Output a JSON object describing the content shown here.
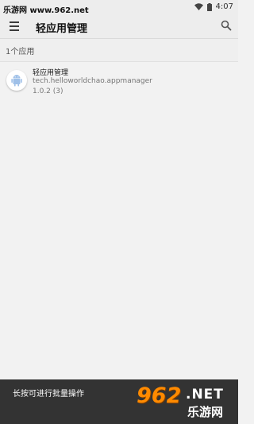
{
  "status_bar": {
    "watermark": "乐游网 www.962.net",
    "time": "4:07"
  },
  "app_bar": {
    "title": "轻应用管理"
  },
  "section": {
    "count_label": "1个应用"
  },
  "apps": [
    {
      "name": "轻应用管理",
      "package": "tech.helloworldchao.appmanager",
      "version": "1.0.2 (3)"
    }
  ],
  "snackbar": {
    "message": "长按可进行批量操作"
  },
  "logo": {
    "number": "962",
    "net": ".NET",
    "cn": "乐游网"
  },
  "colors": {
    "app_bar_bg": "#ededed",
    "snackbar_bg": "#333333",
    "android_green": "#9fc0e8",
    "logo_orange": "#ff8a00"
  }
}
